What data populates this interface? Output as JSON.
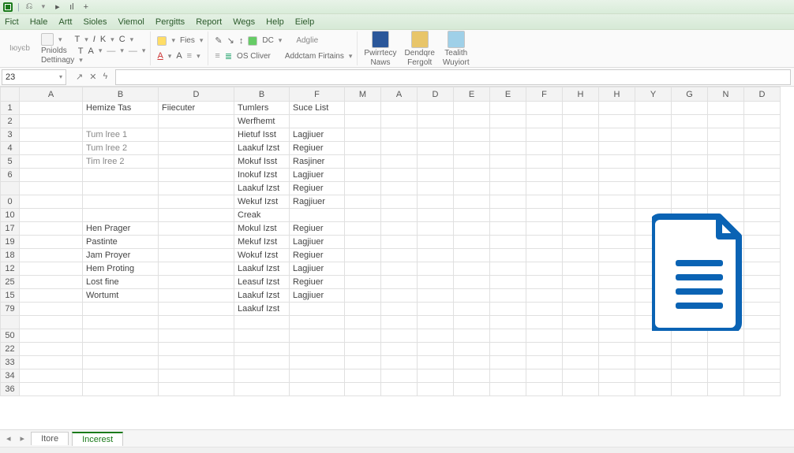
{
  "titlebar": {
    "qa_undo": "⎌",
    "qa_play": "▸",
    "qa_pause": "ıl",
    "qa_plus": "+"
  },
  "menu": {
    "items": [
      "Fict",
      "Hale",
      "Artt",
      "Sioles",
      "Viemol",
      "Pergitts",
      "Report",
      "Wegs",
      "Help",
      "Eielp"
    ]
  },
  "ribbon": {
    "side": "Iюуєb",
    "pnolds": "Pniolds",
    "dettinagy": "Dettinagy",
    "fies": "Fies",
    "dc": "DC",
    "adglie": "Adglie",
    "oscliver": "OS Cliver",
    "addctam": "Addctam Firtains",
    "pwntecy": "Pwirrtecy",
    "naws": "Naws",
    "dendqre": "Dendqre",
    "fergolt": "Fergolt",
    "tealith": "Tealith",
    "wuyiort": "Wuyiort"
  },
  "namebox": "23",
  "columns": [
    "A",
    "B",
    "D",
    "B",
    "F",
    "M",
    "A",
    "D",
    "E",
    "E",
    "F",
    "H",
    "H",
    "Y",
    "G",
    "N",
    "D"
  ],
  "rows": [
    "1",
    "2",
    "3",
    "4",
    "5",
    "6",
    "",
    "0",
    "10",
    "17",
    "19",
    "18",
    "12",
    "25",
    "15",
    "79",
    "",
    "50",
    "22",
    "33",
    "34",
    "36"
  ],
  "data": {
    "r0": {
      "b": "Hemize Tas",
      "d": "Fiiecuter",
      "b2": "Tumlers",
      "f": "Suce List"
    },
    "r1": {
      "b2": "Werfhemt"
    },
    "r2": {
      "b": "Tum lree 1",
      "b2": "Hietuf Isst",
      "f": "Lagjiuer"
    },
    "r3": {
      "b": "Tum lree 2",
      "b2": "Laakuf Izst",
      "f": "Regiuer"
    },
    "r4": {
      "b": "Tim lree 2",
      "b2": "Mokuf Isst",
      "f": "Rasjiner"
    },
    "r5": {
      "b2": "Inokuf Izst",
      "f": "Lagjiuer"
    },
    "r6": {
      "b2": "Laakuf Izst",
      "f": "Regiuer"
    },
    "r7": {
      "b2": "Wekuf Izst",
      "f": "Ragjiuer"
    },
    "r8": {
      "b2": "Creak"
    },
    "r9": {
      "b": "Hen Prager",
      "b2": "Mokul Izst",
      "f": "Regiuer"
    },
    "r10": {
      "b": "Pastinte",
      "b2": "Mekuf Izst",
      "f": "Lagjiuer"
    },
    "r11": {
      "b": "Jam Proyer",
      "b2": "Wokuf Izst",
      "f": "Regiuer"
    },
    "r12": {
      "b": "Hem Proting",
      "b2": "Laakuf Izst",
      "f": "Lagjiuer"
    },
    "r13": {
      "b": "Lost fine",
      "b2": "Leasuf Izst",
      "f": "Regiuer"
    },
    "r14": {
      "b": "Wortumt",
      "b2": "Laakuf Izst",
      "f": "Lagjiuer"
    },
    "r15": {
      "b2": "Laakuf Izst"
    }
  },
  "tabs": {
    "t1": "Itore",
    "t2": "Incerest"
  }
}
